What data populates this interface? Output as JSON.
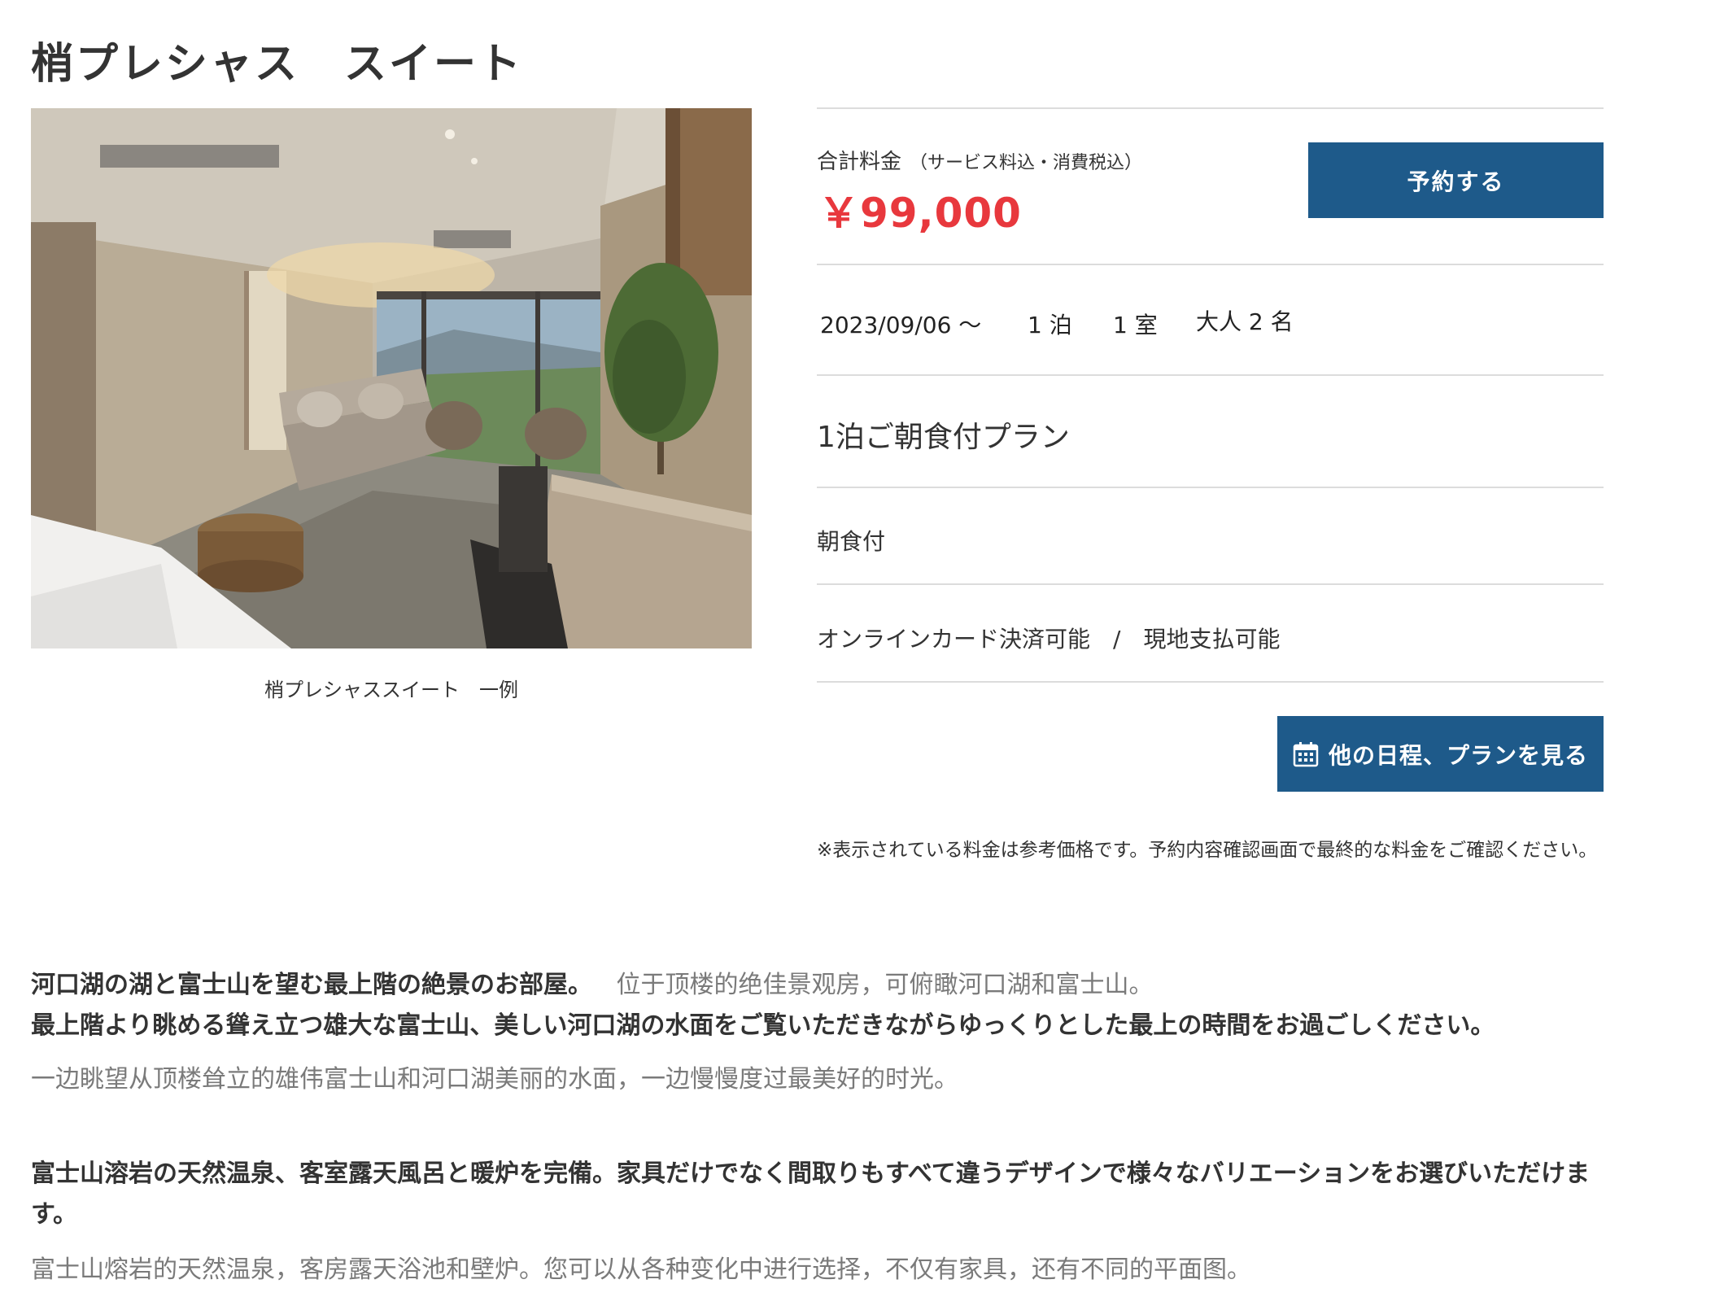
{
  "room": {
    "title": "梢プレシャス　スイート",
    "photo_caption": "梢プレシャススイート　一例"
  },
  "pricing": {
    "total_label": "合計料金",
    "total_note": "（サービス料込・消費税込）",
    "price": "￥99,000",
    "reserve_button": "予約する",
    "price_color": "#e8383d",
    "button_color": "#1e5a8a"
  },
  "stay": {
    "date": "2023/09/06 〜",
    "nights": "1 泊",
    "rooms": "1 室",
    "guests": "大人 2 名"
  },
  "plan": {
    "name": "1泊ご朝食付プラン",
    "meal": "朝食付",
    "payment_online": "オンラインカード決済可能",
    "payment_separator": "/",
    "payment_onsite": "現地支払可能"
  },
  "actions": {
    "other_dates_button": "他の日程、プランを見る",
    "other_dates_icon": "calendar-icon"
  },
  "disclaimer": "※表示されている料金は参考価格です。予約内容確認画面で最終的な料金をご確認ください。",
  "description": {
    "p1_ja": "河口湖の湖と富士山を望む最上階の絶景のお部屋。",
    "p1_zh": "位于顶楼的绝佳景观房，可俯瞰河口湖和富士山。",
    "p2_ja": "最上階より眺める聳え立つ雄大な富士山、美しい河口湖の水面をご覧いただきながらゆっくりとした最上の時間をお過ごしください。",
    "p2_zh": "一边眺望从顶楼耸立的雄伟富士山和河口湖美丽的水面，一边慢慢度过最美好的时光。",
    "p3_ja": "富士山溶岩の天然温泉、客室露天風呂と暖炉を完備。家具だけでなく間取りもすべて違うデザインで様々なバリエーションをお選びいただけます。",
    "p3_zh": "富士山熔岩的天然温泉，客房露天浴池和壁炉。您可以从各种变化中进行选择，不仅有家具，还有不同的平面图。"
  }
}
